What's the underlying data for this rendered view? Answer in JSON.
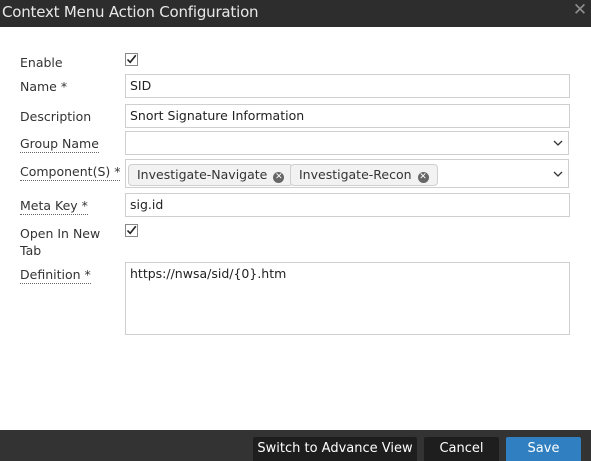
{
  "dialog": {
    "title": "Context Menu Action Configuration",
    "close_glyph": "✕"
  },
  "form": {
    "enable": {
      "label": "Enable",
      "checked": true
    },
    "name": {
      "label": "Name *",
      "value": "SID"
    },
    "description": {
      "label": "Description",
      "value": "Snort Signature Information"
    },
    "group_name": {
      "label": "Group Name",
      "value": ""
    },
    "components": {
      "label": "Component(S) *",
      "tags": [
        "Investigate-Navigate",
        "Investigate-Recon"
      ]
    },
    "meta_key": {
      "label": "Meta Key *",
      "value": "sig.id"
    },
    "open_in_new_tab": {
      "label": "Open In New Tab",
      "checked": true
    },
    "definition": {
      "label": "Definition *",
      "value": "https://nwsa/sid/{0}.htm"
    }
  },
  "footer": {
    "advance_label": "Switch to Advance View",
    "cancel_label": "Cancel",
    "save_label": "Save"
  },
  "colors": {
    "titlebar": "#2d2d2d",
    "footer": "#333333",
    "primary_button": "#2f7fc1",
    "dark_button": "#1e1e1e"
  },
  "icons": {
    "check": "check-icon",
    "dropdown": "chevron-down-icon",
    "tag_remove": "remove-tag-icon",
    "close": "close-icon"
  }
}
